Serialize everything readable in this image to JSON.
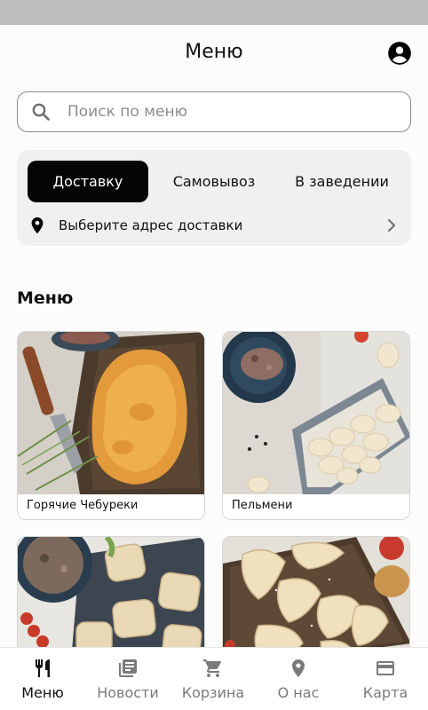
{
  "header": {
    "title": "Меню"
  },
  "search": {
    "placeholder": "Поиск по меню",
    "value": ""
  },
  "order_modes": {
    "tabs": [
      "Доставку",
      "Самовывоз",
      "В заведении"
    ],
    "selected": "Доставку",
    "address_prompt": "Выберите адрес доставки"
  },
  "menu": {
    "section_title": "Меню",
    "categories": [
      {
        "label": "Горячие Чебуреки"
      },
      {
        "label": "Пельмени"
      },
      {
        "label": ""
      },
      {
        "label": ""
      }
    ]
  },
  "bottom_nav": {
    "items": [
      {
        "label": "Меню",
        "icon": "fork-knife-icon",
        "active": true
      },
      {
        "label": "Новости",
        "icon": "news-icon",
        "active": false
      },
      {
        "label": "Корзина",
        "icon": "cart-icon",
        "active": false
      },
      {
        "label": "О нас",
        "icon": "location-pin-icon",
        "active": false
      },
      {
        "label": "Карта",
        "icon": "credit-card-icon",
        "active": false
      }
    ]
  },
  "colors": {
    "accent": "#050505",
    "background": "#fcfcfc",
    "panel": "#f0f0f0",
    "status_bar": "#bdbdbd",
    "nav_inactive": "#7a7a7a"
  }
}
